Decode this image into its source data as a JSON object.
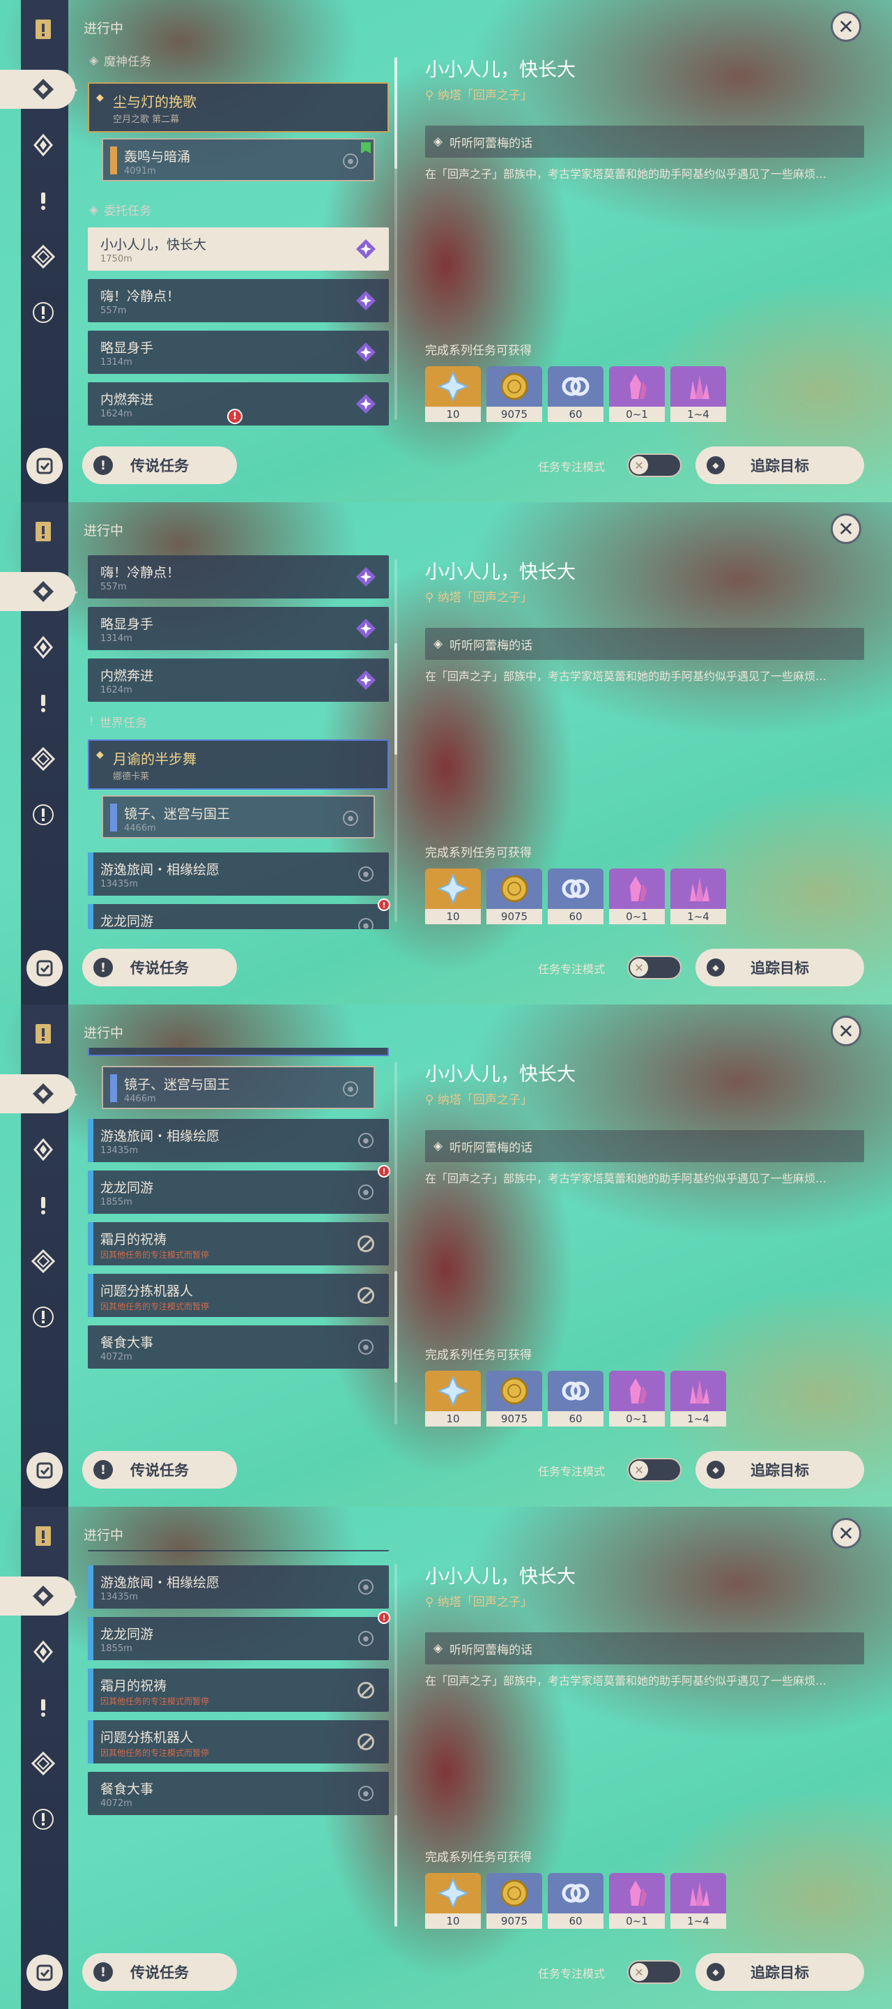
{
  "header": {
    "title": "进行中"
  },
  "detail": {
    "title": "小小人儿，快长大",
    "location": "纳塔「回声之子」",
    "step": "听听阿蕾梅的话",
    "description": "在「回声之子」部族中，考古学家塔莫蕾和她的助手阿基约似乎遇见了一些麻烦…",
    "reward_label": "完成系列任务可获得",
    "rewards": [
      {
        "icon": "primogem-icon",
        "count": "10",
        "color": "#d79a3a"
      },
      {
        "icon": "mora-icon",
        "count": "9075",
        "color": "#6a7fb8"
      },
      {
        "icon": "exp-icon",
        "count": "60",
        "color": "#6a7fb8"
      },
      {
        "icon": "crystal-icon",
        "count": "0~1",
        "color": "#9f66c9"
      },
      {
        "icon": "crystal-pile-icon",
        "count": "1~4",
        "color": "#9f66c9"
      }
    ]
  },
  "footer": {
    "legend_button": "传说任务",
    "focus_mode_label": "任务专注模式",
    "track_button": "追踪目标"
  },
  "groups": {
    "archon": "魔神任务",
    "commission": "委托任务",
    "world": "世界任务"
  },
  "quests": {
    "archon_main": {
      "title": "尘与灯的挽歌",
      "sub": "空月之歌 第二幕"
    },
    "archon_step": {
      "title": "轰鸣与暗涌",
      "dist": "4091m"
    },
    "q1": {
      "title": "小小人儿，快长大",
      "dist": "1750m"
    },
    "q2": {
      "title": "嗨！冷静点！",
      "dist": "557m"
    },
    "q3": {
      "title": "略显身手",
      "dist": "1314m"
    },
    "q4": {
      "title": "内燃奔进",
      "dist": "1624m"
    },
    "world_main": {
      "title": "月谕的半步舞",
      "sub": "娜德卡莱"
    },
    "world_step": {
      "title": "镜子、迷宫与国王",
      "dist": "4466m"
    },
    "w1": {
      "title": "游逸旅闻・相缘绘愿",
      "dist": "13435m"
    },
    "w2": {
      "title": "龙龙同游",
      "dist": "1855m"
    },
    "w3": {
      "title": "霜月的祝祷",
      "warn": "因其他任务的专注模式而暂停"
    },
    "w4": {
      "title": "问题分拣机器人",
      "warn": "因其他任务的专注模式而暂停"
    },
    "w5": {
      "title": "餐食大事",
      "dist": "4072m"
    }
  }
}
